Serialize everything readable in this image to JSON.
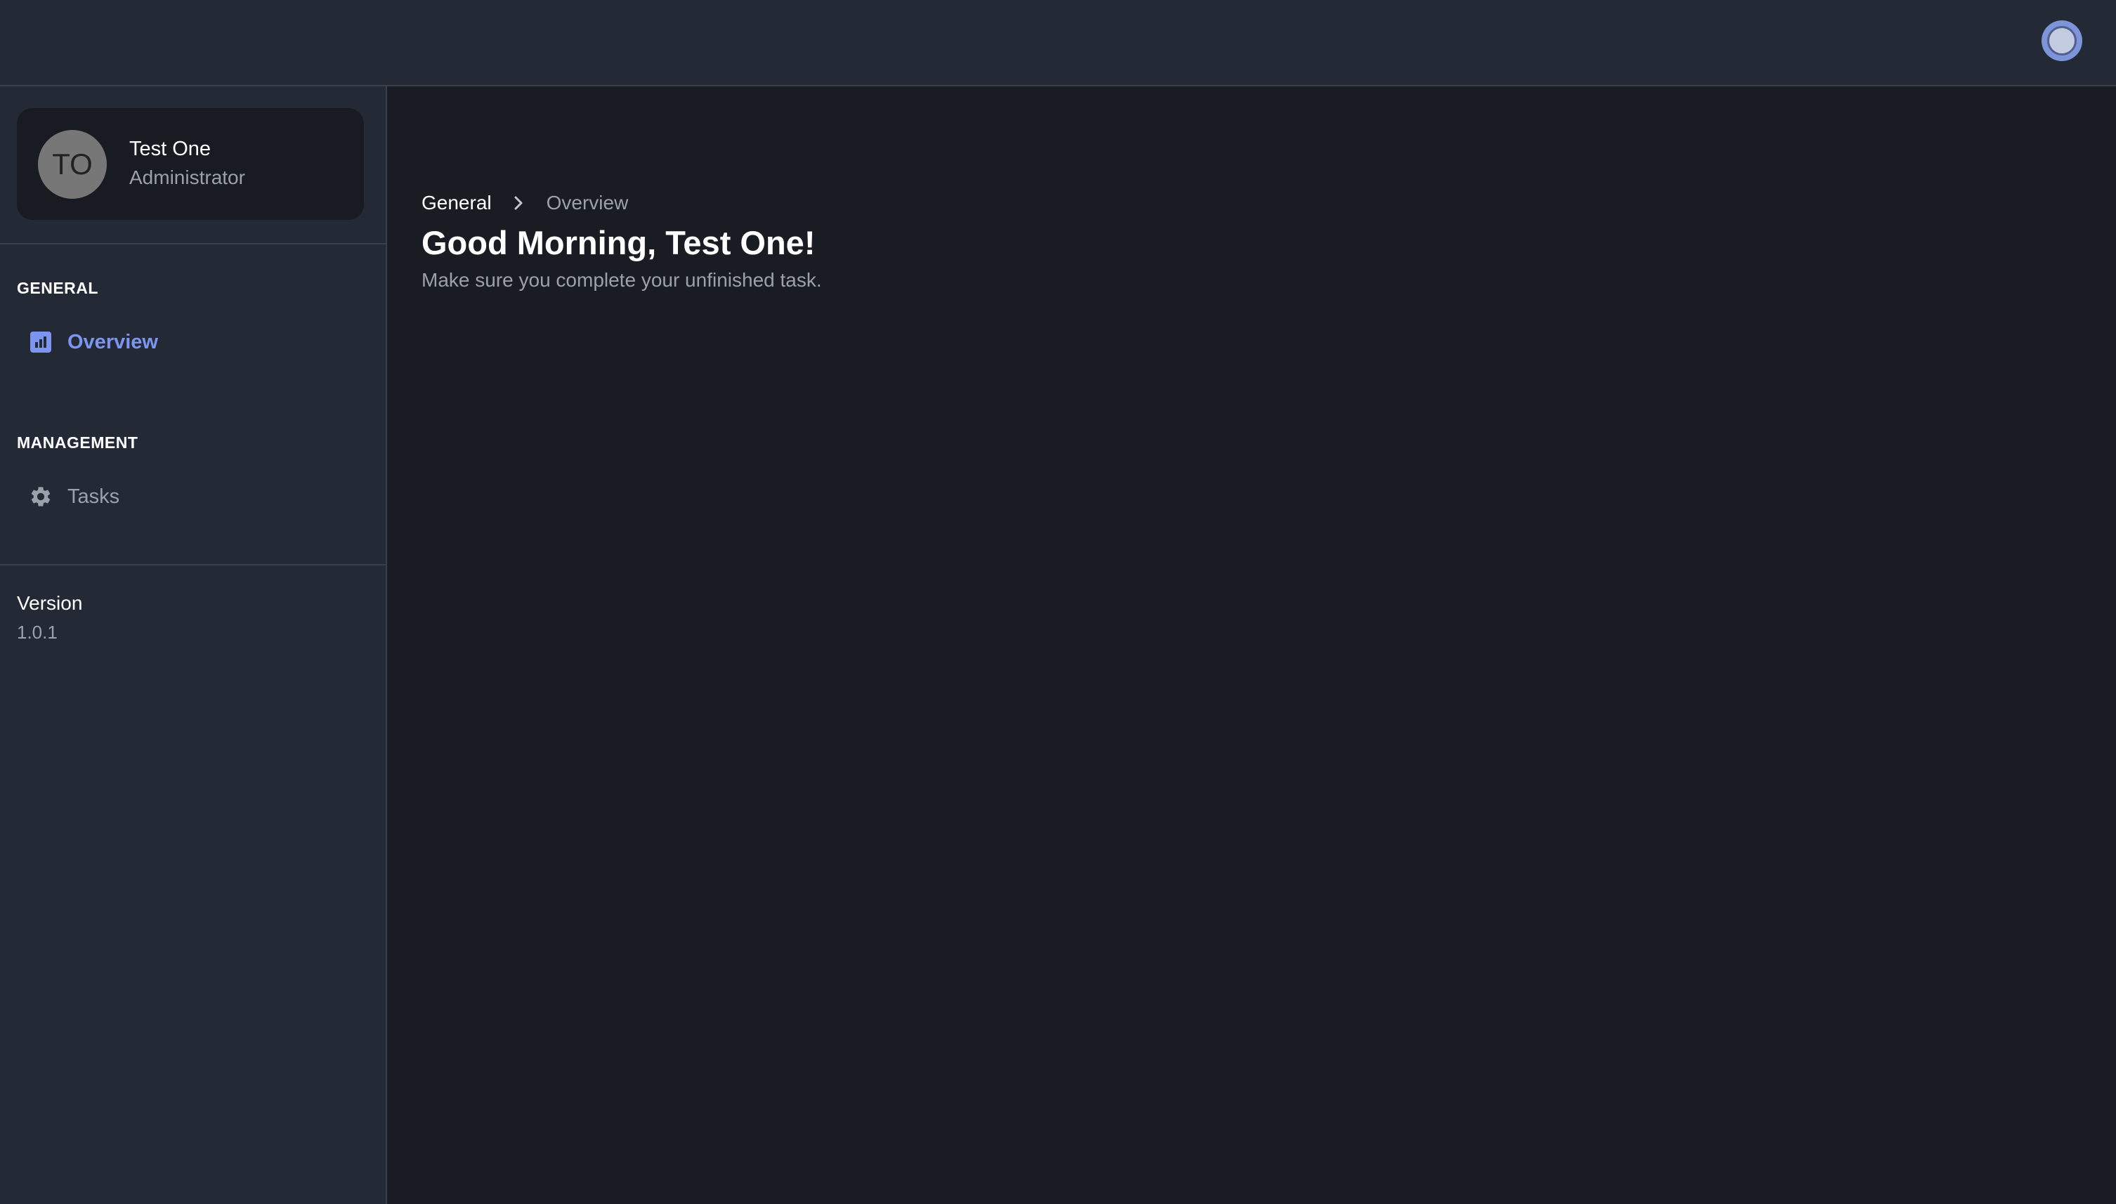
{
  "topbar": {
    "theme_toggle_icon": "theme-toggle-icon"
  },
  "sidebar": {
    "profile": {
      "initials": "TO",
      "name": "Test One",
      "role": "Administrator"
    },
    "sections": [
      {
        "title": "GENERAL",
        "items": [
          {
            "label": "Overview",
            "icon": "chart-icon",
            "active": true
          }
        ]
      },
      {
        "title": "MANAGEMENT",
        "items": [
          {
            "label": "Tasks",
            "icon": "gear-icon",
            "active": false
          }
        ]
      }
    ],
    "version": {
      "label": "Version",
      "value": "1.0.1"
    }
  },
  "main": {
    "breadcrumb": {
      "parent": "General",
      "current": "Overview"
    },
    "title": "Good Morning, Test One!",
    "subtitle": "Make sure you complete your unfinished task."
  },
  "colors": {
    "accent": "#7b95f0",
    "sidebar_bg": "#242a35",
    "main_bg": "#191c23",
    "muted_text": "#9ba1ab"
  }
}
